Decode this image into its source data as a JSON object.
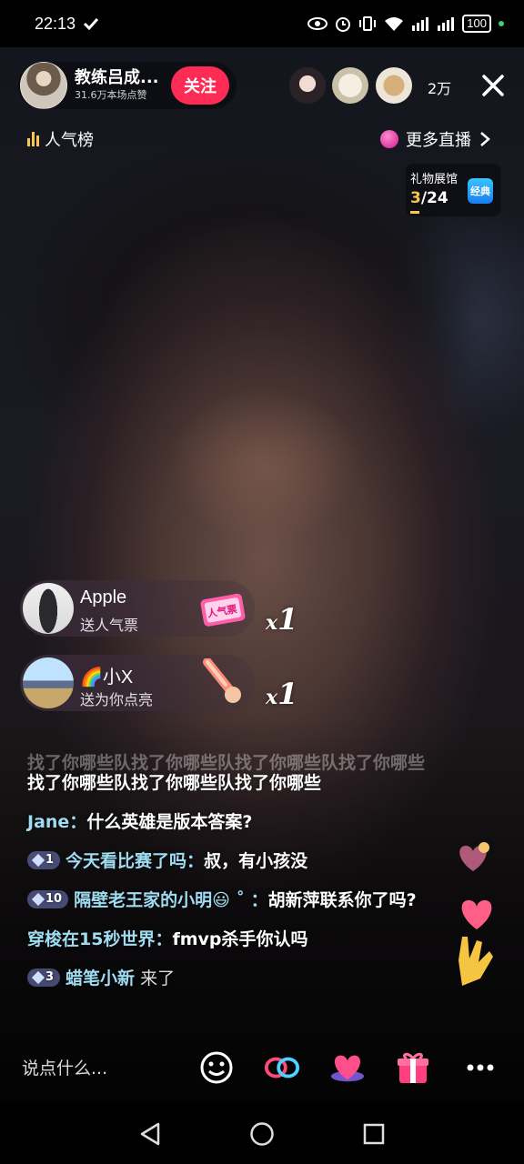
{
  "status_bar": {
    "time": "22:13",
    "battery": "100"
  },
  "anchor": {
    "name": "教练吕成...",
    "likes": "31.6万本场点赞",
    "follow_label": "关注"
  },
  "viewers": {
    "count": "2万"
  },
  "rank": {
    "label": "人气榜"
  },
  "more_live": {
    "label": "更多直播"
  },
  "gift_hall": {
    "title": "礼物展馆",
    "current": "3",
    "total": "/24",
    "badge": "经典"
  },
  "gifts": [
    {
      "user": "Apple",
      "action": "送人气票",
      "count_prefix": "x",
      "count": "1",
      "gift_icon": "ticket-gift-icon",
      "gift_label": "人气票"
    },
    {
      "user": "🌈小X",
      "action": "送为你点亮",
      "count_prefix": "x",
      "count": "1",
      "gift_icon": "glow-stick-icon"
    }
  ],
  "comments": {
    "faded_line": "找了你哪些队找了你哪些队找了你哪些队找了你哪些",
    "lines": [
      {
        "name": "",
        "text": "找了你哪些队找了你哪些队找了你哪些"
      },
      {
        "name": "Jane：",
        "text": "什么英雄是版本答案?"
      },
      {
        "level": "1",
        "name": "今天看比赛了吗：",
        "text": "叔，有小孩没"
      },
      {
        "level": "10",
        "name": "隔壁老王家的小明😃 ˚ ：",
        "text": "胡新萍联系你了吗?"
      },
      {
        "name": "穿梭在15秒世界：",
        "text": "fmvp杀手你认吗"
      },
      {
        "level": "3",
        "name": "蜡笔小新",
        "text": " 来了"
      }
    ]
  },
  "bottom_bar": {
    "input_placeholder": "说点什么...",
    "icons": [
      "emoji-icon",
      "link-icon",
      "heart-icon",
      "gift-icon",
      "more-icon"
    ]
  },
  "colors": {
    "follow": "#fe2c55",
    "name": "#9fdcf2",
    "accent_yellow": "#f7c64a"
  }
}
